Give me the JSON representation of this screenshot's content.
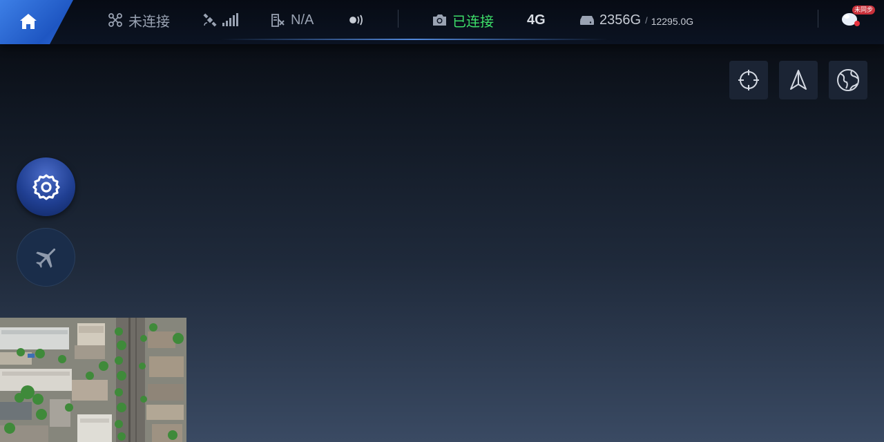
{
  "header": {
    "home_icon": "home-icon",
    "drone": {
      "icon": "drone-icon",
      "status": "未连接"
    },
    "gps": {
      "icon": "satellite-icon",
      "signal_icon": "signal-bars-icon"
    },
    "rtk": {
      "icon": "rtk-icon",
      "value": "N/A"
    },
    "transmission": {
      "icon": "transmission-icon"
    },
    "camera": {
      "icon": "camera-icon",
      "status": "已连接",
      "status_color": "#3ee06a"
    },
    "network": {
      "label": "4G"
    },
    "storage": {
      "icon": "storage-icon",
      "used": "2356G",
      "separator": "/",
      "total": "12295.0G"
    },
    "sync": {
      "icon": "cloud-sync-icon",
      "badge": "未同步",
      "badge_color": "#c8303a"
    }
  },
  "map_tools": [
    {
      "name": "locate",
      "icon": "crosshair-icon"
    },
    {
      "name": "north",
      "icon": "navigation-arrow-icon"
    },
    {
      "name": "map-layer",
      "icon": "globe-icon"
    }
  ],
  "side_buttons": [
    {
      "name": "settings",
      "icon": "gear-icon"
    },
    {
      "name": "flight",
      "icon": "airplane-icon"
    }
  ],
  "minimap": {
    "type": "satellite-imagery"
  },
  "colors": {
    "accent": "#2b66d6",
    "connected": "#3ee06a",
    "muted_text": "#9aa3b3"
  }
}
